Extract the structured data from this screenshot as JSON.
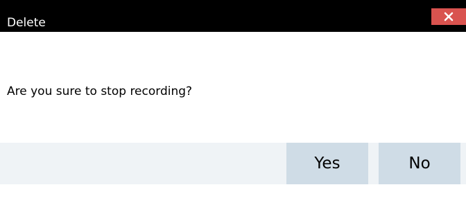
{
  "dialog": {
    "title": "Delete",
    "close_icon": "close-icon",
    "message": "Are you sure to stop recording?",
    "buttons": {
      "yes_label": "Yes",
      "no_label": "No"
    }
  },
  "colors": {
    "titlebar_bg": "#000000",
    "title_text": "#ffffff",
    "close_bg": "#d9534f",
    "footer_bg": "#eff3f6",
    "button_bg": "#cfdce6"
  }
}
